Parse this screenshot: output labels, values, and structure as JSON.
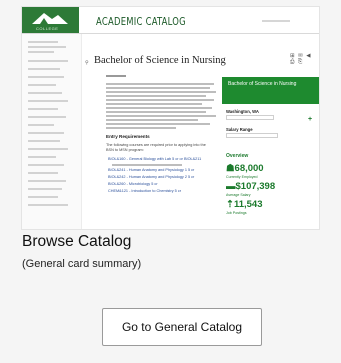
{
  "screenshot": {
    "logo_sub": "COLLEGE",
    "catalog_title": "ACADEMIC CATALOG",
    "program_title": "Bachelor of Science in Nursing",
    "share_icons": "⊞ ✉ ◀ ⎙ ⎘",
    "section_title": "Entry Requirements",
    "intro_text": "The following courses are required prior to applying into the",
    "intro_text2": "BSN to MSN program:",
    "course_links": [
      "BIOL&160 - General Biology with Lab 5 cr or BIOL&211",
      "BIOL&241 - Human Anatomy and Physiology 1 5 cr",
      "BIOL&242 - Human Anatomy and Physiology 2 5 cr",
      "BIOL&260 - Microbiology 5 cr",
      "CHEM&121 - Introduction to Chemistry 5 cr"
    ],
    "sidebar_card_title": "Bachelor of Science in Nursing",
    "location_label": "Washington, WA",
    "salary_label": "Salary Range",
    "overview_title": "Overview",
    "stats": [
      {
        "icon": "☗",
        "value": "68,000",
        "caption": "Currently Employed"
      },
      {
        "icon": "▬",
        "value": "$107,398",
        "caption": "Average Salary"
      },
      {
        "icon": "⇡",
        "value": "11,543",
        "caption": "Job Postings"
      }
    ],
    "plus": "+"
  },
  "card": {
    "title": "Browse Catalog",
    "summary": "(General card summary)",
    "button_label": "Go to General Catalog"
  },
  "colors": {
    "brand_green": "#2d7a37",
    "accent_green": "#1e8a2f",
    "link_blue": "#2a4f9a"
  }
}
